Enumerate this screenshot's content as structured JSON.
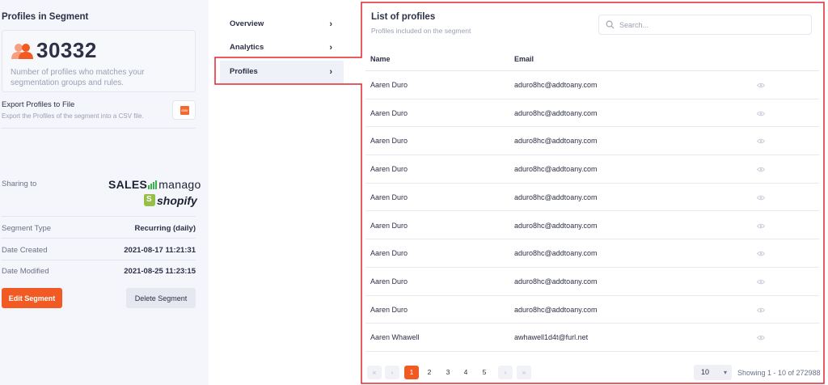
{
  "segment": {
    "title": "Profiles in Segment",
    "count": "30332",
    "count_desc": "Number of profiles who matches your segmentation groups and rules.",
    "export_title": "Export Profiles to File",
    "export_desc": "Export the Profiles of the segment into a CSV file.",
    "export_icon": "csv-file-icon",
    "sharing_label": "Sharing to",
    "brand_salesmanago_a": "SALES",
    "brand_salesmanago_b": "manago",
    "brand_shopify": "shopify",
    "details": [
      {
        "label": "Segment Type",
        "value": "Recurring (daily)"
      },
      {
        "label": "Date Created",
        "value": "2021-08-17 11:21:31"
      },
      {
        "label": "Date Modified",
        "value": "2021-08-25 11:23:15"
      }
    ],
    "edit_label": "Edit Segment",
    "delete_label": "Delete Segment"
  },
  "nav": {
    "items": [
      {
        "label": "Overview",
        "icon": "chevron-right-icon"
      },
      {
        "label": "Analytics",
        "icon": "chevron-right-icon"
      },
      {
        "label": "Profiles",
        "icon": "chevron-right-icon",
        "active": true
      }
    ]
  },
  "list": {
    "title": "List of profiles",
    "subtitle": "Profiles included on the segment",
    "search_placeholder": "Search...",
    "columns": [
      "Name",
      "Email"
    ],
    "rows": [
      {
        "name": "Aaren Duro",
        "email": "aduro8hc@addtoany.com"
      },
      {
        "name": "Aaren Duro",
        "email": "aduro8hc@addtoany.com"
      },
      {
        "name": "Aaren Duro",
        "email": "aduro8hc@addtoany.com"
      },
      {
        "name": "Aaren Duro",
        "email": "aduro8hc@addtoany.com"
      },
      {
        "name": "Aaren Duro",
        "email": "aduro8hc@addtoany.com"
      },
      {
        "name": "Aaren Duro",
        "email": "aduro8hc@addtoany.com"
      },
      {
        "name": "Aaren Duro",
        "email": "aduro8hc@addtoany.com"
      },
      {
        "name": "Aaren Duro",
        "email": "aduro8hc@addtoany.com"
      },
      {
        "name": "Aaren Duro",
        "email": "aduro8hc@addtoany.com"
      },
      {
        "name": "Aaren Whawell",
        "email": "awhawell1d4t@furl.net"
      }
    ]
  },
  "pagination": {
    "first": "«",
    "prev": "‹",
    "pages": [
      "1",
      "2",
      "3",
      "4",
      "5"
    ],
    "current": "1",
    "next": "›",
    "last": "»",
    "per_page": "10",
    "showing": "Showing 1 - 10 of 272988"
  },
  "colors": {
    "accent": "#f25a23",
    "highlight": "#e0252b",
    "brand_green": "#3bb54a",
    "shopify_green": "#95bf47"
  }
}
